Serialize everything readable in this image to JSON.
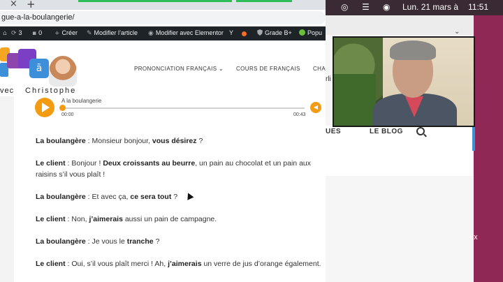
{
  "browser": {
    "tab_close_glyph": "×",
    "new_tab_glyph": "+",
    "url": "gue-a-la-boulangerie/"
  },
  "adminbar": {
    "updates_count": "3",
    "comments_count": "0",
    "new_label": "Créer",
    "edit_article_label": "Modifier l’article",
    "elementor_label": "Modifier avec Elementor",
    "yoast_label": "Y",
    "grade_label": "Grade B+",
    "popup_label": "Popu"
  },
  "site": {
    "logo_text_left": "vec",
    "logo_text_right": "Christophe",
    "logo_glyph": "ã",
    "nav": {
      "pronunciation": "PRONONCIATION FRANÇAIS ⌄",
      "courses": "COURS DE FRANÇAIS",
      "partial": "CHA"
    }
  },
  "player": {
    "title": "A la boulangerie",
    "current_time": "00:00",
    "total_time": "00:43",
    "progress": 0.0
  },
  "dialogue": [
    {
      "speaker": "La boulangère",
      "before": " : Monsieur bonjour, ",
      "bold": "vous désirez",
      "after": " ?"
    },
    {
      "speaker": "Le client",
      "before": " : Bonjour ! ",
      "bold": "Deux croissants au beurre",
      "after": ", un pain au chocolat et un pain aux raisins s’il vous plaît !"
    },
    {
      "speaker": "La boulangère",
      "before": " : Et avec ça, ",
      "bold": "ce sera tout",
      "after": " ?"
    },
    {
      "speaker": "Le client",
      "before": " : Non, ",
      "bold": "j’aimerais",
      "after": " aussi un pain de campagne."
    },
    {
      "speaker": "La boulangère",
      "before": " : Je vous le ",
      "bold": "tranche",
      "after": " ?"
    },
    {
      "speaker": "Le client",
      "before": " : Oui, s’il vous plaît merci ! Ah, ",
      "bold": "j’aimerais",
      "after": " un verre de jus d’orange également."
    }
  ],
  "mac": {
    "clock_date": "Lun. 21 mars à",
    "clock_time": "11:51"
  },
  "background_page": {
    "nav_partial": "UES",
    "blog_label": "LE BLOG",
    "side_text": "rli",
    "aux_text": "ux"
  },
  "colors": {
    "accent_orange": "#f39c12",
    "adminbar_bg": "#1d2327",
    "mac_menubar_bg": "#3a2a33",
    "desktop_bg": "#8f2855"
  }
}
